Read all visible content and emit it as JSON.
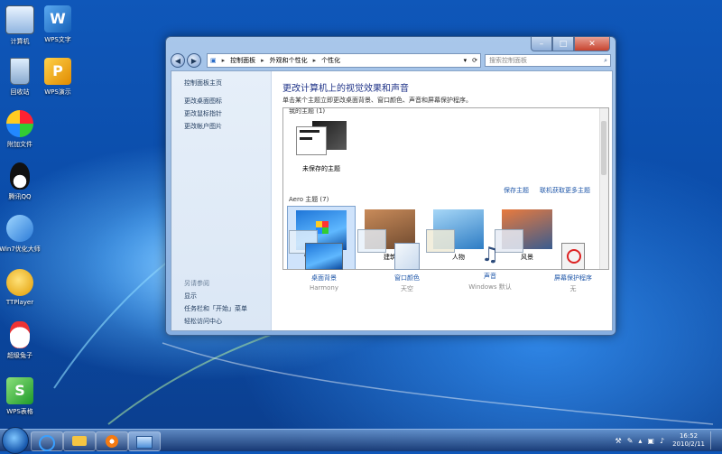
{
  "desktop": {
    "icons": [
      {
        "label": "计算机"
      },
      {
        "label": "WPS文字"
      },
      {
        "label": "回收站"
      },
      {
        "label": "WPS演示"
      },
      {
        "label": "附加文件"
      },
      {
        "label": "腾讯QQ"
      },
      {
        "label": "Win7优化大师"
      },
      {
        "label": "TTPlayer"
      },
      {
        "label": "超级兔子"
      },
      {
        "label": "WPS表格"
      }
    ]
  },
  "window": {
    "breadcrumb": [
      "控制面板",
      "外观和个性化",
      "个性化"
    ],
    "search_placeholder": "搜索控制面板",
    "sidebar": {
      "home": "控制面板主页",
      "links": [
        "更改桌面图标",
        "更改鼠标指针",
        "更改帐户图片"
      ],
      "see_also": "另请参阅",
      "see_also_links": [
        "显示",
        "任务栏和「开始」菜单",
        "轻松访问中心"
      ]
    },
    "main": {
      "title": "更改计算机上的视觉效果和声音",
      "description": "单击某个主题立即更改桌面背景、窗口颜色、声音和屏幕保护程序。",
      "my_themes_label": "我的主题 (1)",
      "unsaved_theme": "未保存的主题",
      "save_theme": "保存主题",
      "online_themes": "联机获取更多主题",
      "aero_label": "Aero 主题 (7)",
      "aero_themes": [
        "Windows 7",
        "建筑",
        "人物",
        "风景"
      ],
      "bottom": [
        {
          "label": "桌面背景",
          "sub": "Harmony"
        },
        {
          "label": "窗口颜色",
          "sub": "天空"
        },
        {
          "label": "声音",
          "sub": "Windows 默认"
        },
        {
          "label": "屏幕保护程序",
          "sub": "无"
        }
      ]
    }
  },
  "taskbar": {
    "time": "16:52",
    "date": "2010/2/11"
  },
  "colors": {
    "desktop_blue": "#0a4aa6",
    "link_blue": "#1e56a8",
    "title_blue": "#1e3287"
  }
}
